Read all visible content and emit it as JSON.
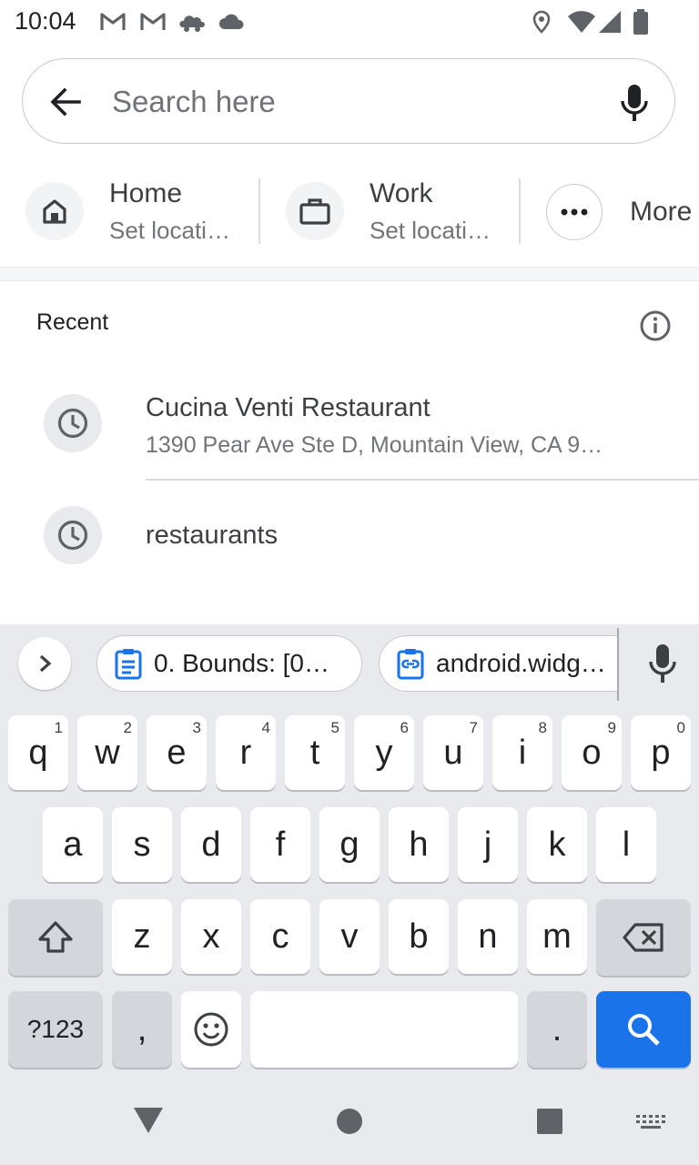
{
  "status_bar": {
    "time": "10:04",
    "left_icons": [
      "gmail-icon",
      "gmail-icon",
      "cloud-car-icon",
      "cloud-icon"
    ],
    "right_icons": [
      "location-icon",
      "wifi-icon",
      "signal-icon",
      "battery-icon"
    ]
  },
  "search": {
    "placeholder": "Search here",
    "back_icon": "arrow-back-icon",
    "mic_icon": "mic-icon"
  },
  "shortcuts": [
    {
      "icon": "home-icon",
      "title": "Home",
      "subtitle": "Set locati…"
    },
    {
      "icon": "briefcase-icon",
      "title": "Work",
      "subtitle": "Set locati…"
    },
    {
      "icon": "more-dots-icon",
      "title": "More",
      "subtitle": ""
    }
  ],
  "recent": {
    "title": "Recent",
    "items": [
      {
        "title": "Cucina Venti Restaurant",
        "subtitle": "1390 Pear Ave Ste D, Mountain View, CA 9…"
      },
      {
        "title": "restaurants",
        "subtitle": ""
      }
    ]
  },
  "keyboard": {
    "chips": [
      "0. Bounds: [0…",
      "android.widg…"
    ],
    "row1": [
      {
        "label": "q",
        "hint": "1"
      },
      {
        "label": "w",
        "hint": "2"
      },
      {
        "label": "e",
        "hint": "3"
      },
      {
        "label": "r",
        "hint": "4"
      },
      {
        "label": "t",
        "hint": "5"
      },
      {
        "label": "y",
        "hint": "6"
      },
      {
        "label": "u",
        "hint": "7"
      },
      {
        "label": "i",
        "hint": "8"
      },
      {
        "label": "o",
        "hint": "9"
      },
      {
        "label": "p",
        "hint": "0"
      }
    ],
    "row2": [
      "a",
      "s",
      "d",
      "f",
      "g",
      "h",
      "j",
      "k",
      "l"
    ],
    "row3": [
      "z",
      "x",
      "c",
      "v",
      "b",
      "n",
      "m"
    ],
    "symbols_label": "?123",
    "comma_label": ",",
    "period_label": ".",
    "accent_color": "#1a73e8"
  }
}
